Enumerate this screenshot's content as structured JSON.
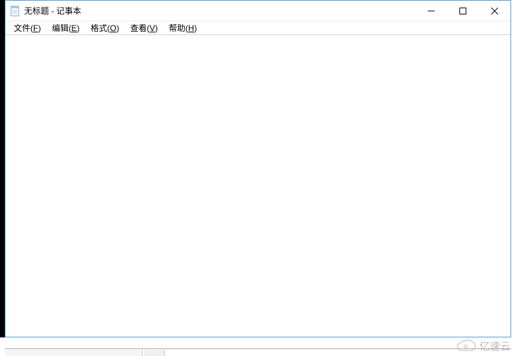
{
  "window": {
    "title": "无标题 - 记事本"
  },
  "menu": {
    "items": [
      {
        "label": "文件",
        "accel": "F"
      },
      {
        "label": "编辑",
        "accel": "E"
      },
      {
        "label": "格式",
        "accel": "O"
      },
      {
        "label": "查看",
        "accel": "V"
      },
      {
        "label": "帮助",
        "accel": "H"
      }
    ]
  },
  "editor": {
    "content": ""
  },
  "watermark": {
    "text": "亿速云"
  }
}
